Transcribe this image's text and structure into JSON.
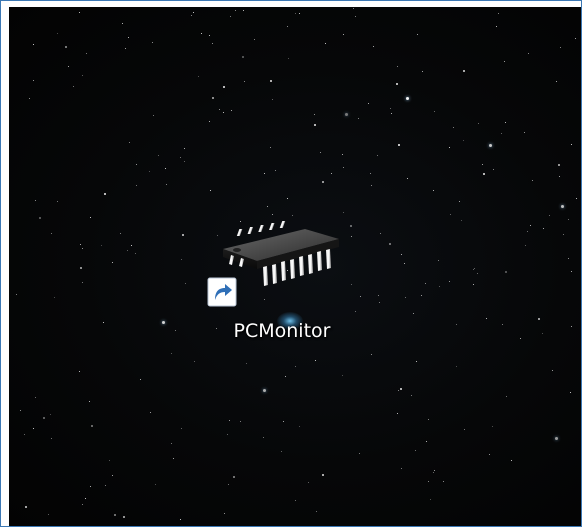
{
  "desktop": {
    "wallpaper": "starfield",
    "shortcuts": [
      {
        "label": "PCMonitor",
        "icon": "microchip-icon",
        "overlay_icon": "shortcut-arrow-icon"
      }
    ]
  },
  "colors": {
    "frame_border": "#3c78b4",
    "desktop_background": "#050607",
    "label_text": "#ffffff",
    "arrow_badge": "#2f6fb7"
  }
}
